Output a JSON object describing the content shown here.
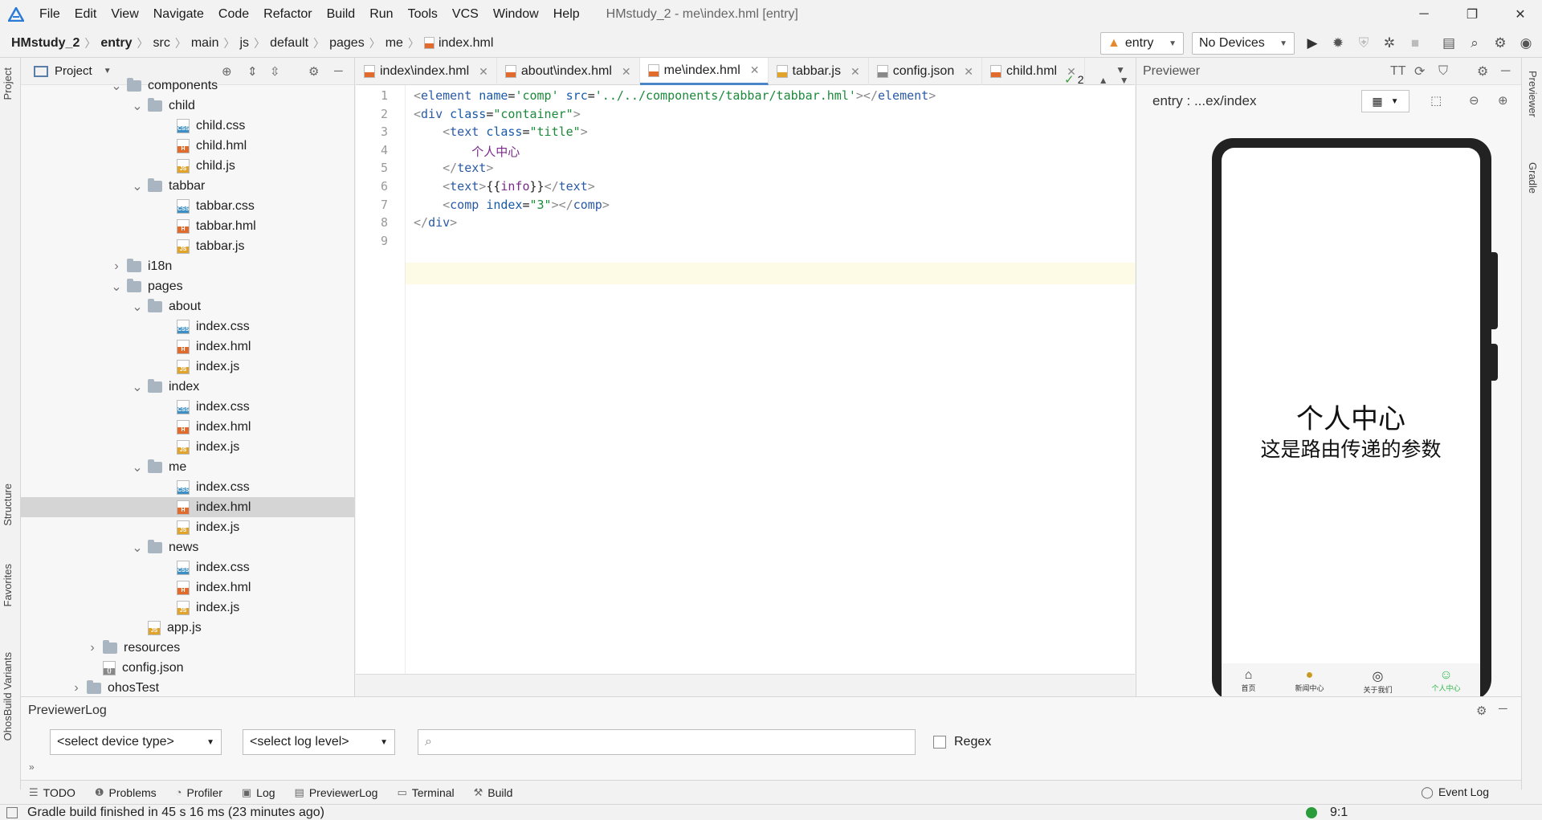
{
  "menubar": {
    "items": [
      "File",
      "Edit",
      "View",
      "Navigate",
      "Code",
      "Refactor",
      "Build",
      "Run",
      "Tools",
      "VCS",
      "Window",
      "Help"
    ],
    "window_title": "HMstudy_2 - me\\index.hml [entry]",
    "minimize": "─",
    "maximize": "❐",
    "close": "✕"
  },
  "breadcrumb": [
    "HMstudy_2",
    "entry",
    "src",
    "main",
    "js",
    "default",
    "pages",
    "me",
    "index.hml"
  ],
  "toolbar": {
    "run_config": "entry",
    "device": "No Devices"
  },
  "left_strip": {
    "project": "Project",
    "structure": "Structure",
    "favorites": "Favorites",
    "ohos_build_variants": "OhosBuild Variants"
  },
  "right_strip": {
    "previewer": "Previewer",
    "gradle": "Gradle"
  },
  "project_panel": {
    "title": "Project",
    "tree": [
      {
        "label": "components",
        "type": "folder",
        "depth": 3,
        "expanded": true
      },
      {
        "label": "child",
        "type": "folder",
        "depth": 4,
        "expanded": true
      },
      {
        "label": "child.css",
        "type": "css",
        "depth": 5
      },
      {
        "label": "child.hml",
        "type": "hml",
        "depth": 5
      },
      {
        "label": "child.js",
        "type": "js",
        "depth": 5
      },
      {
        "label": "tabbar",
        "type": "folder",
        "depth": 4,
        "expanded": true
      },
      {
        "label": "tabbar.css",
        "type": "css",
        "depth": 5
      },
      {
        "label": "tabbar.hml",
        "type": "hml",
        "depth": 5
      },
      {
        "label": "tabbar.js",
        "type": "js",
        "depth": 5
      },
      {
        "label": "i18n",
        "type": "folder",
        "depth": 3,
        "expanded": false
      },
      {
        "label": "pages",
        "type": "folder",
        "depth": 3,
        "expanded": true
      },
      {
        "label": "about",
        "type": "folder",
        "depth": 4,
        "expanded": true
      },
      {
        "label": "index.css",
        "type": "css",
        "depth": 5
      },
      {
        "label": "index.hml",
        "type": "hml",
        "depth": 5
      },
      {
        "label": "index.js",
        "type": "js",
        "depth": 5
      },
      {
        "label": "index",
        "type": "folder",
        "depth": 4,
        "expanded": true
      },
      {
        "label": "index.css",
        "type": "css",
        "depth": 5
      },
      {
        "label": "index.hml",
        "type": "hml",
        "depth": 5
      },
      {
        "label": "index.js",
        "type": "js",
        "depth": 5
      },
      {
        "label": "me",
        "type": "folder",
        "depth": 4,
        "expanded": true
      },
      {
        "label": "index.css",
        "type": "css",
        "depth": 5
      },
      {
        "label": "index.hml",
        "type": "hml",
        "depth": 5,
        "selected": true
      },
      {
        "label": "index.js",
        "type": "js",
        "depth": 5
      },
      {
        "label": "news",
        "type": "folder",
        "depth": 4,
        "expanded": true
      },
      {
        "label": "index.css",
        "type": "css",
        "depth": 5
      },
      {
        "label": "index.hml",
        "type": "hml",
        "depth": 5
      },
      {
        "label": "index.js",
        "type": "js",
        "depth": 5
      },
      {
        "label": "app.js",
        "type": "js",
        "depth": 4
      },
      {
        "label": "resources",
        "type": "folder",
        "depth": 2,
        "expanded": false
      },
      {
        "label": "config.json",
        "type": "json",
        "depth": 2
      },
      {
        "label": "ohosTest",
        "type": "folder",
        "depth": 1,
        "expanded": false
      }
    ]
  },
  "editor_tabs": [
    {
      "label": "index\\index.hml",
      "type": "hml"
    },
    {
      "label": "about\\index.hml",
      "type": "hml"
    },
    {
      "label": "me\\index.hml",
      "type": "hml",
      "active": true
    },
    {
      "label": "tabbar.js",
      "type": "js"
    },
    {
      "label": "config.json",
      "type": "json"
    },
    {
      "label": "child.hml",
      "type": "hml"
    }
  ],
  "editor": {
    "inspection_count": "2",
    "line_numbers": [
      "1",
      "2",
      "3",
      "4",
      "5",
      "6",
      "7",
      "8",
      "9"
    ]
  },
  "previewer": {
    "title": "Previewer",
    "path": "entry : ...ex/index",
    "screen_title": "个人中心",
    "screen_info": "这是路由传递的参数",
    "tabs": [
      "首页",
      "新闻中心",
      "关于我们",
      "个人中心"
    ]
  },
  "previewer_log": {
    "title": "PreviewerLog",
    "device_type": "<select device type>",
    "log_level": "<select log level>",
    "search_placeholder": "",
    "regex": "Regex"
  },
  "tool_windows": [
    "TODO",
    "Problems",
    "Profiler",
    "Log",
    "PreviewerLog",
    "Terminal",
    "Build"
  ],
  "event_log": "Event Log",
  "status": {
    "message": "Gradle build finished in 45 s 16 ms (23 minutes ago)",
    "position": "9:1"
  },
  "colors": {
    "accent": "#4a86c8",
    "selection": "#d5d5d5",
    "current_line": "#fdfbe6"
  }
}
